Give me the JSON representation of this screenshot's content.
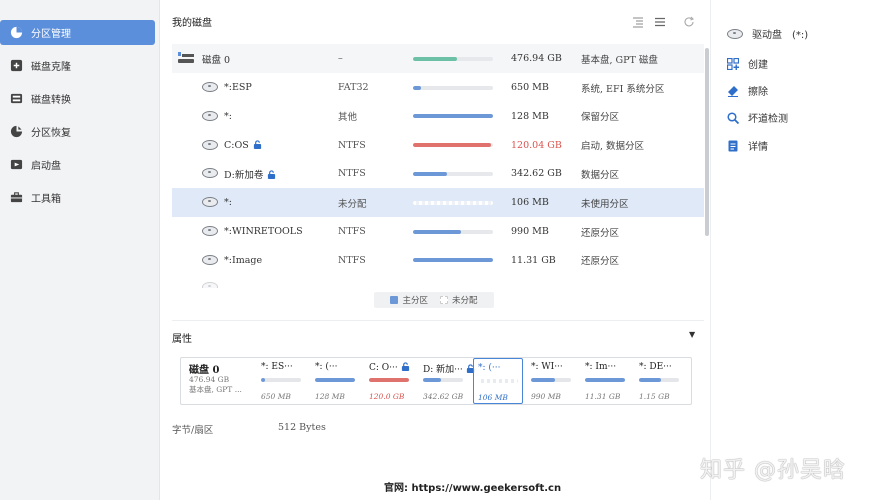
{
  "sidebar": {
    "items": [
      {
        "label": "分区管理",
        "icon": "pie-chart-icon",
        "active": true
      },
      {
        "label": "磁盘克隆",
        "icon": "clone-icon",
        "active": false
      },
      {
        "label": "磁盘转换",
        "icon": "convert-icon",
        "active": false
      },
      {
        "label": "分区恢复",
        "icon": "recovery-icon",
        "active": false
      },
      {
        "label": "启动盘",
        "icon": "boot-disk-icon",
        "active": false
      },
      {
        "label": "工具箱",
        "icon": "toolbox-icon",
        "active": false
      }
    ]
  },
  "main": {
    "title": "我的磁盘",
    "toolbar_icons": [
      "list-view-icon",
      "menu-icon",
      "refresh-icon"
    ],
    "disk": {
      "name": "磁盘 0",
      "fs": "–",
      "capacity": "476.94 GB",
      "type": "基本盘, GPT 磁盘",
      "used_fraction": 0.55
    },
    "partitions": [
      {
        "name": "*:ESP",
        "fs": "FAT32",
        "capacity": "650 MB",
        "type": "系统, EFI 系统分区",
        "used_fraction": 0.1,
        "locked": false,
        "warning": false,
        "selected": false,
        "unallocated": false
      },
      {
        "name": "*:",
        "fs": "其他",
        "capacity": "128 MB",
        "type": "保留分区",
        "used_fraction": 1.0,
        "locked": false,
        "warning": false,
        "selected": false,
        "unallocated": false
      },
      {
        "name": "C:OS",
        "fs": "NTFS",
        "capacity": "120.04 GB",
        "type": "启动, 数据分区",
        "used_fraction": 0.97,
        "locked": true,
        "warning": true,
        "selected": false,
        "unallocated": false
      },
      {
        "name": "D:新加卷",
        "fs": "NTFS",
        "capacity": "342.62 GB",
        "type": "数据分区",
        "used_fraction": 0.42,
        "locked": true,
        "warning": false,
        "selected": false,
        "unallocated": false
      },
      {
        "name": "*:",
        "fs": "未分配",
        "capacity": "106 MB",
        "type": "未使用分区",
        "used_fraction": 0.0,
        "locked": false,
        "warning": false,
        "selected": true,
        "unallocated": true
      },
      {
        "name": "*:WINRETOOLS",
        "fs": "NTFS",
        "capacity": "990 MB",
        "type": "还原分区",
        "used_fraction": 0.6,
        "locked": false,
        "warning": false,
        "selected": false,
        "unallocated": false
      },
      {
        "name": "*:Image",
        "fs": "NTFS",
        "capacity": "11.31 GB",
        "type": "还原分区",
        "used_fraction": 1.0,
        "locked": false,
        "warning": false,
        "selected": false,
        "unallocated": false
      }
    ],
    "legend": {
      "primary": "主分区",
      "unallocated": "未分配"
    },
    "properties_title": "属性",
    "map": {
      "disk_name": "磁盘 0",
      "disk_size": "476.94 GB",
      "disk_type": "基本盘, GPT ...",
      "cells": [
        {
          "name": "*: ES···",
          "size": "650 MB",
          "used_fraction": 0.1,
          "locked": false,
          "warning": false,
          "selected": false,
          "unallocated": false
        },
        {
          "name": "*: (···",
          "size": "128 MB",
          "used_fraction": 1.0,
          "locked": false,
          "warning": false,
          "selected": false,
          "unallocated": false
        },
        {
          "name": "C: O···",
          "size": "120.0 GB",
          "used_fraction": 1.0,
          "locked": true,
          "warning": true,
          "selected": false,
          "unallocated": false
        },
        {
          "name": "D: 新加···",
          "size": "342.62 GB",
          "used_fraction": 0.45,
          "locked": true,
          "warning": false,
          "selected": false,
          "unallocated": false
        },
        {
          "name": "*: (···",
          "size": "106 MB",
          "used_fraction": 0.0,
          "locked": false,
          "warning": false,
          "selected": true,
          "unallocated": true
        },
        {
          "name": "*: WI···",
          "size": "990 MB",
          "used_fraction": 0.6,
          "locked": false,
          "warning": false,
          "selected": false,
          "unallocated": false
        },
        {
          "name": "*: Im···",
          "size": "11.31 GB",
          "used_fraction": 1.0,
          "locked": false,
          "warning": false,
          "selected": false,
          "unallocated": false
        },
        {
          "name": "*: DE···",
          "size": "1.15 GB",
          "used_fraction": 0.55,
          "locked": false,
          "warning": false,
          "selected": false,
          "unallocated": false
        }
      ]
    },
    "sector_label": "字节/扇区",
    "sector_value": "512 Bytes"
  },
  "right_panel": {
    "drive_label": "驱动盘　(*:)",
    "actions": [
      {
        "label": "创建",
        "icon": "create-icon"
      },
      {
        "label": "擦除",
        "icon": "erase-icon"
      },
      {
        "label": "坏道检测",
        "icon": "bad-sector-icon"
      },
      {
        "label": "详情",
        "icon": "details-icon"
      }
    ]
  },
  "footer": "官网: https://www.geekersoft.cn",
  "watermark": "知乎 @孙吴晗",
  "colors": {
    "accent": "#5b8fdc",
    "bar_teal": "#6cc0a6",
    "bar_blue": "#6d98d8",
    "bar_red": "#e0726d",
    "selection": "#dfe9f7"
  }
}
